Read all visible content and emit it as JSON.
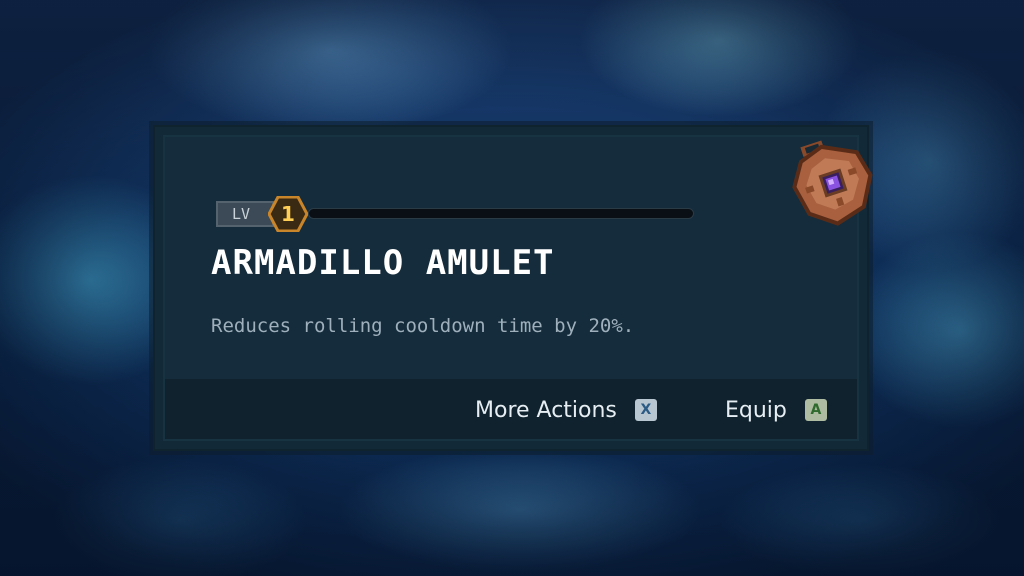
{
  "item": {
    "level_prefix": "LV",
    "level": "1",
    "xp_progress": 0.0,
    "name": "ARMADILLO AMULET",
    "description": "Reduces rolling cooldown time by 20%.",
    "icon": "armadillo-amulet-icon"
  },
  "actions": [
    {
      "label": "More Actions",
      "button": "X"
    },
    {
      "label": "Equip",
      "button": "A"
    }
  ],
  "colors": {
    "accent": "#f0a030",
    "level_number": "#ffcf55",
    "title": "#ffffff",
    "description": "#9fb0bc",
    "panel": "#142c3b"
  }
}
